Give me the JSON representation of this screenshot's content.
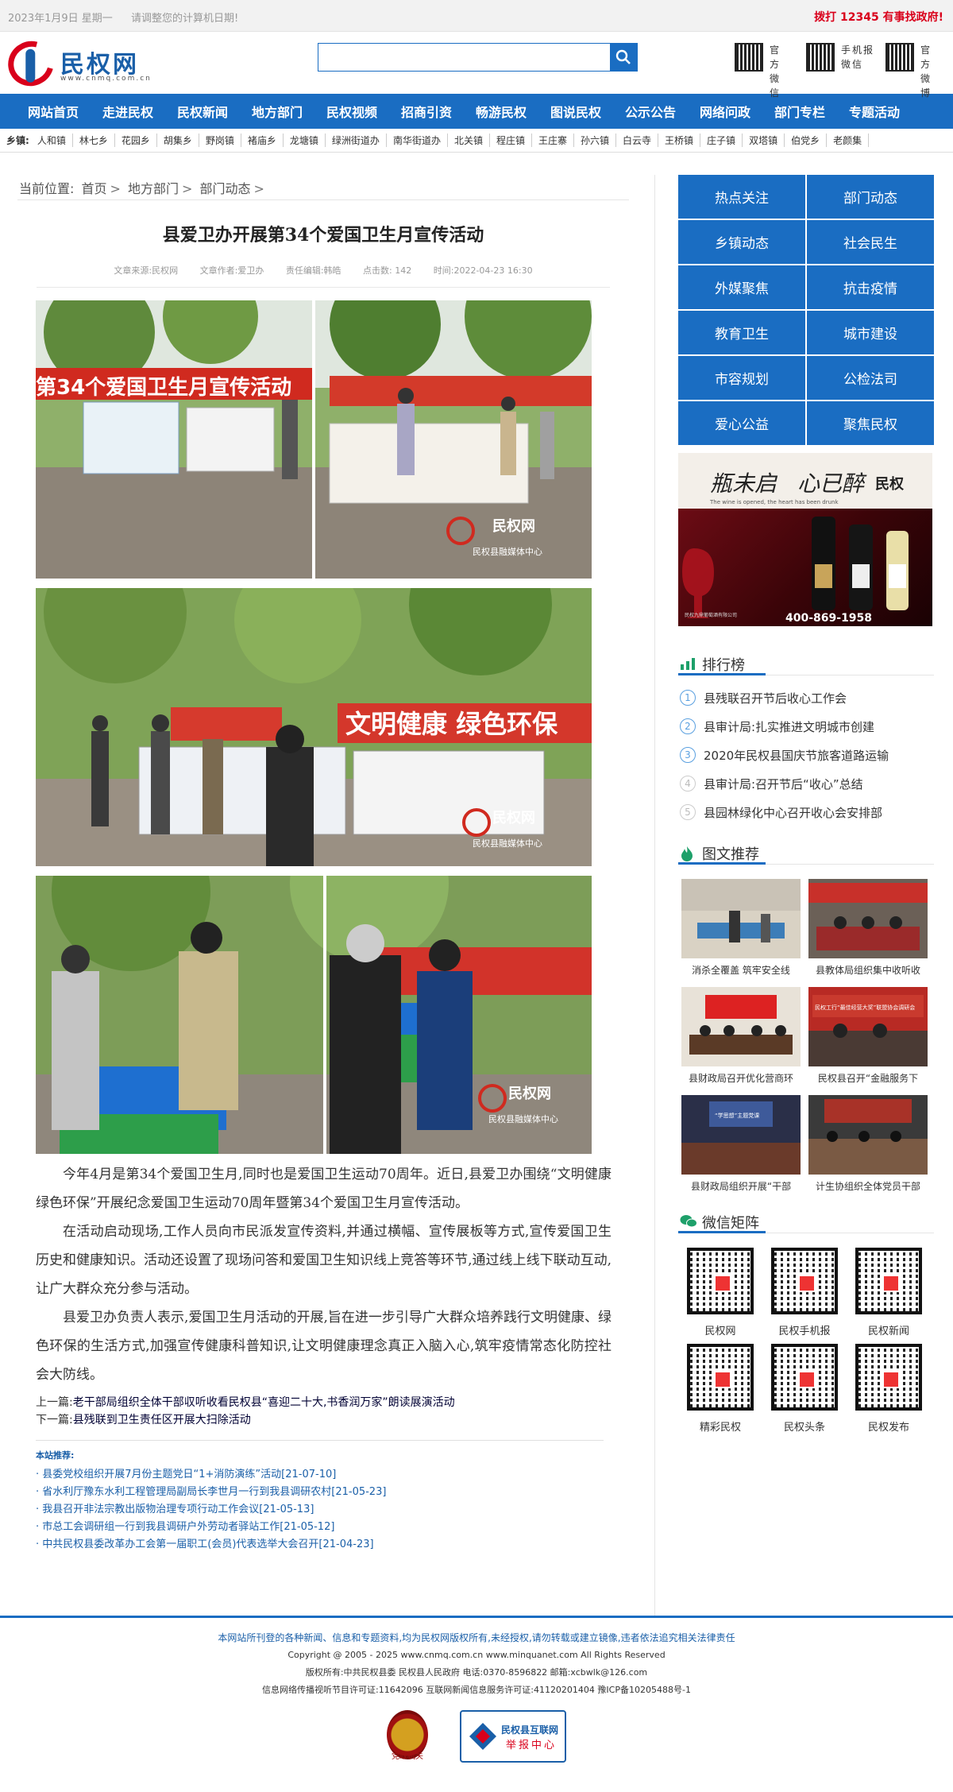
{
  "topbar": {
    "date": "2023年1月9日 星期一",
    "notice": "请调整您的计算机日期!",
    "hotline": "拨打 12345 有事找政府!"
  },
  "logo": {
    "name": "民权网",
    "url": "www.cnmq.com.cn"
  },
  "search": {
    "placeholder": ""
  },
  "qr": {
    "official_label": "官方微信",
    "mobile_label": "手机报微信",
    "weibo_label": "官方微博"
  },
  "nav": [
    "网站首页",
    "走进民权",
    "民权新闻",
    "地方部门",
    "民权视频",
    "招商引资",
    "畅游民权",
    "图说民权",
    "公示公告",
    "网络问政",
    "部门专栏",
    "专题活动"
  ],
  "towns": {
    "label": "乡镇:",
    "items": [
      "人和镇",
      "林七乡",
      "花园乡",
      "胡集乡",
      "野岗镇",
      "褚庙乡",
      "龙塘镇",
      "绿洲街道办",
      "南华街道办",
      "北关镇",
      "程庄镇",
      "王庄寨",
      "孙六镇",
      "白云寺",
      "王桥镇",
      "庄子镇",
      "双塔镇",
      "伯党乡",
      "老颜集"
    ]
  },
  "breadcrumb": {
    "prefix": "当前位置:",
    "items": [
      "首页",
      "地方部门",
      "部门动态"
    ],
    "sep": ">"
  },
  "article": {
    "title": "县爱卫办开展第34个爱国卫生月宣传活动",
    "meta": {
      "source": "文章来源:民权网",
      "author": "文章作者:爱卫办",
      "editor": "责任编辑:韩皓",
      "clicks": "点击数: 142",
      "time": "时间:2022-04-23 16:30"
    },
    "watermark_text": "民权网",
    "watermark_sub": "民权县融媒体中心",
    "watermark_url": "www.cnmq.com.cn",
    "banner_text": "第34个爱国卫生月宣传活动",
    "slogan": "文明健康 绿色环保",
    "paragraphs": [
      "今年4月是第34个爱国卫生月,同时也是爱国卫生运动70周年。近日,县爱卫办围绕“文明健康 绿色环保”开展纪念爱国卫生运动70周年暨第34个爱国卫生月宣传活动。",
      "在活动启动现场,工作人员向市民派发宣传资料,并通过横幅、宣传展板等方式,宣传爱国卫生历史和健康知识。活动还设置了现场问答和爱国卫生知识线上竞答等环节,通过线上线下联动互动,让广大群众充分参与活动。",
      "县爱卫办负责人表示,爱国卫生月活动的开展,旨在进一步引导广大群众培养践行文明健康、绿色环保的生活方式,加强宣传健康科普知识,让文明健康理念真正入脑入心,筑牢疫情常态化防控社会大防线。"
    ],
    "prev_label": "上一篇:",
    "prev": "老干部局组织全体干部収听收看民权县“喜迎二十大,书香润万家”朗读展演活动",
    "next_label": "下一篇:",
    "next": "县残联到卫生责任区开展大扫除活动"
  },
  "recommend": {
    "label": "本站推荐:",
    "items": [
      "· 县委党校组织开展7月份主题党日“1+消防演练”活动[21-07-10]",
      "· 省水利厅豫东水利工程管理局副局长李世月一行到我县调研农村[21-05-23]",
      "· 我县召开非法宗教出版物治理专项行动工作会议[21-05-13]",
      "· 市总工会调研组一行到我县调研户外劳动者驿站工作[21-05-12]",
      "· 中共民权县委改革办工会第一届职工(会员)代表选举大会召开[21-04-23]"
    ]
  },
  "sidebar": {
    "categories": [
      "热点关注",
      "部门动态",
      "乡镇动态",
      "社会民生",
      "外媒聚焦",
      "抗击疫情",
      "教育卫生",
      "城市建设",
      "市容规划",
      "公检法司",
      "爱心公益",
      "聚焦民权"
    ],
    "ad": {
      "line1": "瓶未启",
      "line2": "心已醉",
      "phone": "400-869-1958",
      "brand": "民权",
      "company": "民权九鼎葡萄酒有限公司",
      "slogan": "The wine is opened, the heart has been drunk"
    },
    "rank_title": "排行榜",
    "rank": [
      "县残联召开节后收心工作会",
      "县审计局:扎实推进文明城市创建",
      "2020年民权县国庆节旅客道路运输",
      "县审计局:召开节后“收心”总结",
      "县园林绿化中心召开收心会安排部"
    ],
    "pic_title": "图文推荐",
    "pics": [
      "消杀全覆盖 筑牢安全线",
      "县教体局组织集中收听收",
      "县财政局召开优化营商环",
      "民权县召开“金融服务下",
      "县财政局组织开展“干部",
      "计生协组织全体党员干部"
    ],
    "pic_screen_texts": [
      "民权工行“最佳经营大奖”联盟协会调研会",
      "“学思想”主题党课"
    ],
    "wechat_title": "微信矩阵",
    "wechat": [
      "民权网",
      "民权手机报",
      "民权新闻",
      "精彩民权",
      "民权头条",
      "民权发布"
    ]
  },
  "footer": {
    "line1": "本网站所刊登的各种新闻、信息和专题资料,均为民权网版权所有,未经授权,请勿转载或建立镜像,违者依法追究相关法律责任",
    "line2": "Copyright @ 2005 - 2025 www.cnmq.com.cn www.minquanet.com All Rights Reserved",
    "line3": "版权所有:中共民权县委 民权县人民政府 电话:0370-8596822 邮箱:xcbwlk@126.com",
    "line4": "信息网络传播视听节目许可证:11642096 互联网新闻信息服务许可证:41120201404 豫ICP备10205488号-1",
    "badge1": "党政机关",
    "badge2_title": "民权县互联网",
    "badge2_sub": "举报中心"
  }
}
